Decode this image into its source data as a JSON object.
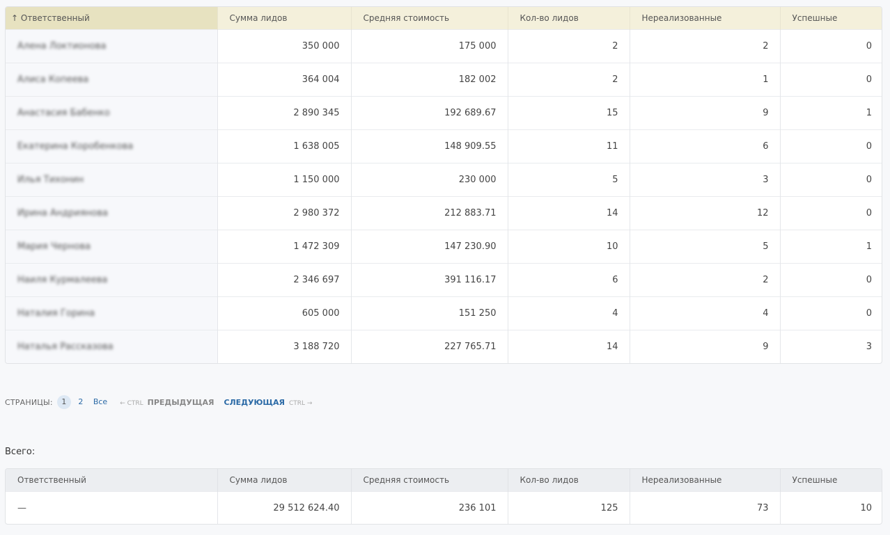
{
  "columns": [
    "Ответственный",
    "Сумма лидов",
    "Средняя стоимость",
    "Кол-во лидов",
    "Нереализованные",
    "Успешные"
  ],
  "sort_indicator": "↑",
  "rows": [
    {
      "name": "Алена Локтионова",
      "sum": "350 000",
      "avg": "175 000",
      "count": "2",
      "unrealized": "2",
      "success": "0"
    },
    {
      "name": "Алиса Копеева",
      "sum": "364 004",
      "avg": "182 002",
      "count": "2",
      "unrealized": "1",
      "success": "0"
    },
    {
      "name": "Анастасия Бабенко",
      "sum": "2 890 345",
      "avg": "192 689.67",
      "count": "15",
      "unrealized": "9",
      "success": "1"
    },
    {
      "name": "Екатерина Коробенкова",
      "sum": "1 638 005",
      "avg": "148 909.55",
      "count": "11",
      "unrealized": "6",
      "success": "0"
    },
    {
      "name": "Илья Тихонин",
      "sum": "1 150 000",
      "avg": "230 000",
      "count": "5",
      "unrealized": "3",
      "success": "0"
    },
    {
      "name": "Ирина Андриянова",
      "sum": "2 980 372",
      "avg": "212 883.71",
      "count": "14",
      "unrealized": "12",
      "success": "0"
    },
    {
      "name": "Мария Чернова",
      "sum": "1 472 309",
      "avg": "147 230.90",
      "count": "10",
      "unrealized": "5",
      "success": "1"
    },
    {
      "name": "Наиля Курмалеева",
      "sum": "2 346 697",
      "avg": "391 116.17",
      "count": "6",
      "unrealized": "2",
      "success": "0"
    },
    {
      "name": "Наталия Горина",
      "sum": "605 000",
      "avg": "151 250",
      "count": "4",
      "unrealized": "4",
      "success": "0"
    },
    {
      "name": "Наталья Рассказова",
      "sum": "3 188 720",
      "avg": "227 765.71",
      "count": "14",
      "unrealized": "9",
      "success": "3"
    }
  ],
  "pager": {
    "label": "СТРАНИЦЫ:",
    "pages": [
      "1",
      "2"
    ],
    "all": "Все",
    "prev_ctrl": "← CTRL",
    "prev": "ПРЕДЫДУЩАЯ",
    "next": "СЛЕДУЮЩАЯ",
    "next_ctrl": "CTRL →"
  },
  "total": {
    "label": "Всего:",
    "name": "—",
    "sum": "29 512 624.40",
    "avg": "236 101",
    "count": "125",
    "unrealized": "73",
    "success": "10"
  }
}
